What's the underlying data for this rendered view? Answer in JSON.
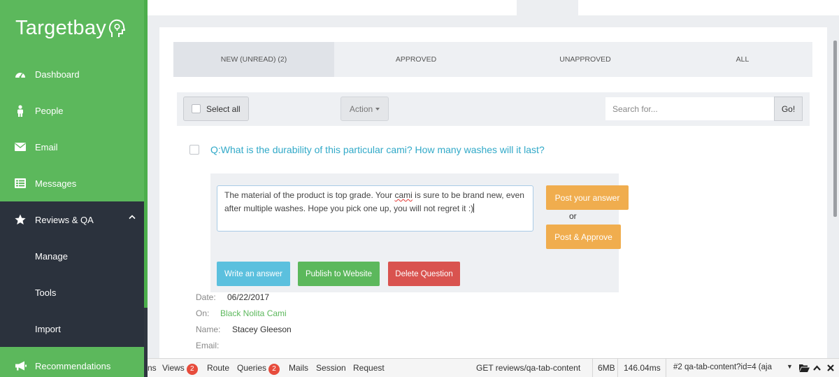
{
  "app": {
    "logo": "Targetbay"
  },
  "sidebar": {
    "items": [
      {
        "label": "Dashboard",
        "icon": "dashboard-icon"
      },
      {
        "label": "People",
        "icon": "person-icon"
      },
      {
        "label": "Email",
        "icon": "envelope-icon"
      },
      {
        "label": "Messages",
        "icon": "messages-icon"
      },
      {
        "label": "Reviews & QA",
        "icon": "star-icon"
      },
      {
        "label": "Recommendations",
        "icon": "megaphone-icon"
      }
    ],
    "subitems": [
      {
        "label": "Manage"
      },
      {
        "label": "Tools"
      },
      {
        "label": "Import"
      }
    ]
  },
  "tabs": [
    {
      "label": "NEW (UNREAD) (2)",
      "active": true
    },
    {
      "label": "APPROVED",
      "active": false
    },
    {
      "label": "UNAPPROVED",
      "active": false
    },
    {
      "label": "ALL",
      "active": false
    }
  ],
  "toolbar": {
    "select_all_label": "Select all",
    "action_label": "Action",
    "search_placeholder": "Search for...",
    "go_label": "Go!"
  },
  "question": {
    "text": "Q:What is the durability of this particular cami? How many washes will it last?",
    "answer_part1": "The material of the product is top grade. Your ",
    "answer_misspelled": "cami",
    "answer_part2": " is sure to be brand new, even after multiple washes. Hope you pick one up, you will not regret it :)",
    "post_answer_label": "Post your answer",
    "or_label": "or",
    "post_approve_label": "Post & Approve",
    "write_answer_label": "Write an answer",
    "publish_label": "Publish to Website",
    "delete_label": "Delete Question",
    "meta": {
      "date_label": "Date:",
      "date": "06/22/2017",
      "on_label": "On:",
      "product": "Black Nolita Cami",
      "name_label": "Name:",
      "name": "Stacey Gleeson",
      "email_label": "Email:"
    }
  },
  "debugbar": {
    "items": [
      {
        "label": "ns"
      },
      {
        "label": "Views",
        "badge": "2"
      },
      {
        "label": "Route"
      },
      {
        "label": "Queries",
        "badge": "2"
      },
      {
        "label": "Mails"
      },
      {
        "label": "Session"
      },
      {
        "label": "Request"
      }
    ],
    "request": "GET reviews/qa-tab-content",
    "memory": "6MB",
    "time": "146.04ms",
    "select_value": "#2 qa-tab-content?id=4 (aja"
  },
  "colors": {
    "sidebar": "#5cb85c",
    "sidebar_dark": "#2b323d",
    "link": "#31a9c8",
    "warning": "#f0ad4e",
    "info": "#5bc0de",
    "success": "#5cb85c",
    "danger": "#d9534f"
  }
}
